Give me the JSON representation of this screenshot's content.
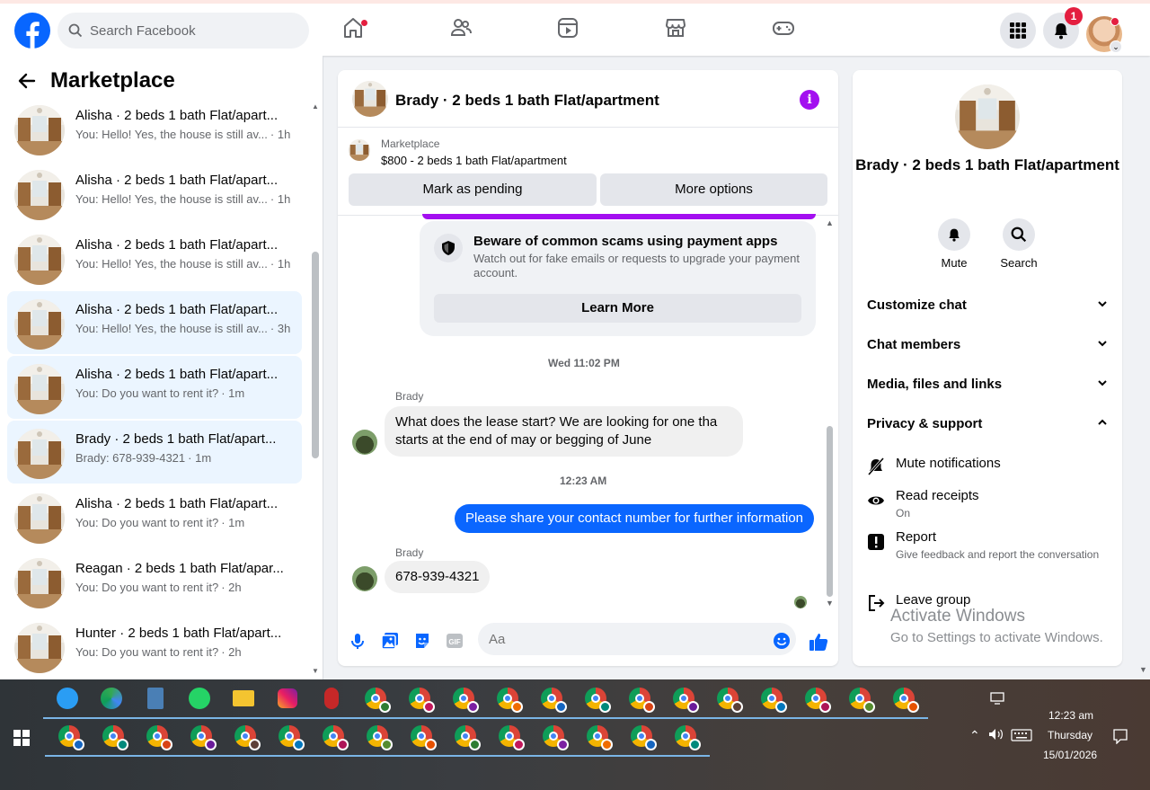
{
  "topbar": {
    "search_placeholder": "Search Facebook",
    "notification_count": "1",
    "nav_icons": [
      "home-icon",
      "friends-icon",
      "video-icon",
      "marketplace-icon",
      "gaming-icon"
    ]
  },
  "left": {
    "title": "Marketplace",
    "conversations": [
      {
        "title": "Alisha · 2 beds 1 bath Flat/apart...",
        "preview": "You: Hello! Yes, the house is still av...",
        "time": "· 1h"
      },
      {
        "title": "Alisha · 2 beds 1 bath Flat/apart...",
        "preview": "You: Hello! Yes, the house is still av...",
        "time": "· 1h"
      },
      {
        "title": "Alisha · 2 beds 1 bath Flat/apart...",
        "preview": "You: Hello! Yes, the house is still av...",
        "time": "· 1h"
      },
      {
        "title": "Alisha · 2 beds 1 bath Flat/apart...",
        "preview": "You: Hello! Yes, the house is still av...",
        "time": "· 3h"
      },
      {
        "title": "Alisha · 2 beds 1 bath Flat/apart...",
        "preview": "You: Do you want to rent it?",
        "time": "· 1m"
      },
      {
        "title": "Brady · 2 beds 1 bath Flat/apart...",
        "preview": "Brady: 678-939-4321",
        "time": "· 1m"
      },
      {
        "title": "Alisha · 2 beds 1 bath Flat/apart...",
        "preview": "You: Do you want to rent it?",
        "time": "· 1m"
      },
      {
        "title": "Reagan · 2 beds 1 bath Flat/apar...",
        "preview": "You: Do you want to rent it?",
        "time": "· 2h"
      },
      {
        "title": "Hunter · 2 beds 1 bath Flat/apart...",
        "preview": "You: Do you want to rent it?",
        "time": "· 2h"
      }
    ]
  },
  "chat": {
    "title": "Brady · 2 beds 1 bath Flat/apartment",
    "marketplace_label": "Marketplace",
    "listing": "$800 - 2 beds 1 bath Flat/apartment",
    "mark_pending": "Mark as pending",
    "more_options": "More options",
    "scam_title": "Beware of common scams using payment apps",
    "scam_text": "Watch out for fake emails or requests to upgrade your payment account.",
    "learn_more": "Learn More",
    "ts1": "Wed 11:02 PM",
    "sender1": "Brady",
    "msg1": "What does the lease start? We are looking for one tha starts at the end of may or begging of June",
    "ts2": "12:23 AM",
    "msg_out": "Please share your contact number for further information",
    "sender2": "Brady",
    "msg2": "678-939-4321",
    "composer_placeholder": "Aa"
  },
  "right": {
    "title": "Brady · 2 beds 1 bath Flat/apartment",
    "mute": "Mute",
    "search": "Search",
    "customize": "Customize chat",
    "members": "Chat members",
    "media": "Media, files and links",
    "privacy": "Privacy & support",
    "mute_notifications": "Mute notifications",
    "read_receipts": "Read receipts",
    "read_receipts_state": "On",
    "report": "Report",
    "report_sub": "Give feedback and report the conversation",
    "leave": "Leave group"
  },
  "watermark": {
    "line1": "Activate Windows",
    "line2": "Go to Settings to activate Windows."
  },
  "taskbar": {
    "time": "12:23 am",
    "day": "Thursday",
    "date": "15/01/2026"
  },
  "colors": {
    "brand": "#0866ff",
    "outgoing_bubble": "#0a66ff",
    "info_purple": "#a30ff0",
    "badge_red": "#e41e3f"
  }
}
